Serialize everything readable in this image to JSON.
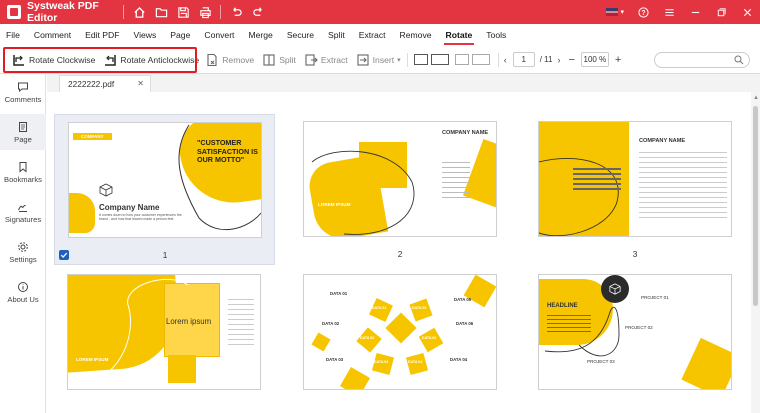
{
  "app": {
    "title": "Systweak PDF Editor"
  },
  "menu": [
    "File",
    "Comment",
    "Edit PDF",
    "Views",
    "Page",
    "Convert",
    "Merge",
    "Secure",
    "Split",
    "Extract",
    "Remove",
    "Rotate",
    "Tools"
  ],
  "menu_active": "Rotate",
  "toolbar": {
    "rotate_cw": "Rotate Clockwise",
    "rotate_ccw": "Rotate Anticlockwise",
    "remove": "Remove",
    "split": "Split",
    "extract": "Extract",
    "insert": "Insert",
    "page_current": "1",
    "page_total": "/ 11",
    "zoom": "100 %"
  },
  "sidebar": [
    "Comments",
    "Page",
    "Bookmarks",
    "Signatures",
    "Settings",
    "About Us"
  ],
  "tab": {
    "filename": "2222222.pdf"
  },
  "pages": [
    {
      "num": "1",
      "texts": {
        "badge": "COMPANY",
        "quote": "\"CUSTOMER SATISFACTION IS OUR MOTTO\"",
        "name": "Company Name",
        "body": "It comes down to how your customer experiences the brand - and how that leaved made a person feel."
      }
    },
    {
      "num": "2",
      "texts": {
        "head": "COMPANY NAME",
        "lorem": "LOREM IPSUM"
      }
    },
    {
      "num": "3",
      "texts": {
        "head": "COMPANY NAME"
      }
    },
    {
      "num": "",
      "texts": {
        "center": "Lorem ipsum",
        "lorem": "LOREM IPSUM"
      }
    },
    {
      "num": "",
      "texts": {
        "d1": "DATA 01",
        "d2": "DATA 02",
        "d3": "DATA 03",
        "d4": "DATA 04",
        "d5": "DATA 05",
        "d6": "DATA 06",
        "c1": "DATA 01",
        "c2": "DATA 02",
        "c3": "DATA 03",
        "c4": "DATA 04",
        "c5": "DATA 05",
        "c6": "DATA 06"
      }
    },
    {
      "num": "",
      "texts": {
        "head": "HEADLINE",
        "p1": "PROJECT 01",
        "p2": "PROJECT 02",
        "p3": "PROJECT 03"
      }
    }
  ],
  "colors": {
    "accent": "#e33541",
    "highlight": "#e01b24",
    "yellow": "#f7c500",
    "checkbox": "#1f5fbf"
  }
}
